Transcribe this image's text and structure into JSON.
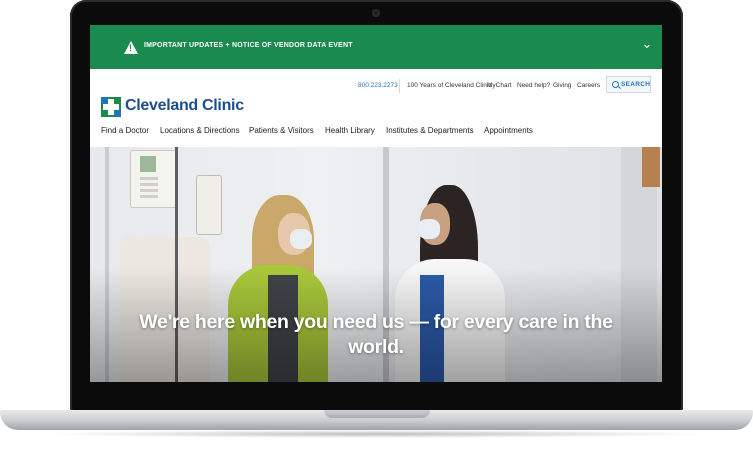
{
  "alert": {
    "text": "IMPORTANT UPDATES + NOTICE OF VENDOR DATA EVENT",
    "icon": "warning-icon",
    "toggle_icon": "chevron-down-icon"
  },
  "utility": {
    "phone": "800.223.2273",
    "links": [
      "100 Years of Cleveland Clinic",
      "MyChart",
      "Need help?",
      "Giving",
      "Careers"
    ],
    "search_label": "SEARCH"
  },
  "brand": {
    "name": "Cleveland Clinic",
    "colors": {
      "green": "#1b8a4e",
      "blue": "#1f73b7",
      "navy": "#1f4f8a"
    }
  },
  "nav": {
    "items": [
      "Find a Doctor",
      "Locations & Directions",
      "Patients & Visitors",
      "Health Library",
      "Institutes & Departments",
      "Appointments"
    ]
  },
  "hero": {
    "headline_line1": "We're here when you need us — for every care in the",
    "headline_line2": "world."
  }
}
